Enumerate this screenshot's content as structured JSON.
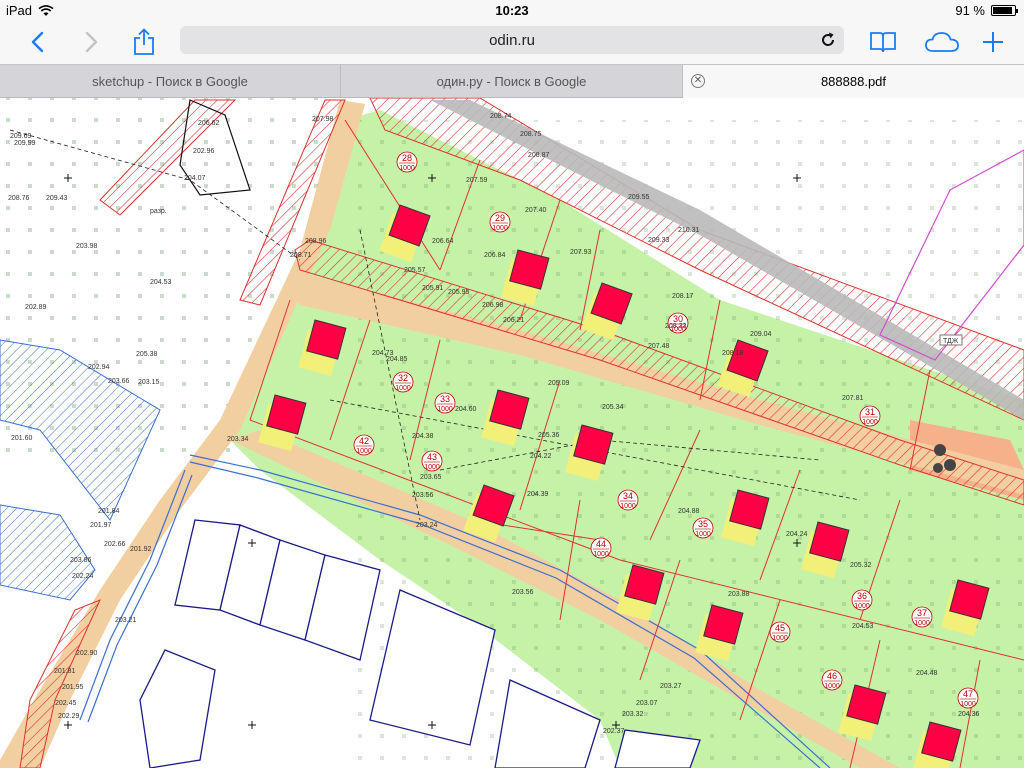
{
  "status": {
    "device": "iPad",
    "time": "10:23",
    "battery": "91 %",
    "battery_level": 0.91
  },
  "browser": {
    "url": "odin.ru"
  },
  "tabs": [
    {
      "label": "sketchup - Поиск в Google"
    },
    {
      "label": "один.ру - Поиск в Google"
    },
    {
      "label": "888888.pdf"
    }
  ],
  "map": {
    "plots": [
      {
        "num": "28",
        "area": "1000"
      },
      {
        "num": "29",
        "area": "1000"
      },
      {
        "num": "30",
        "area": "1000"
      },
      {
        "num": "31",
        "area": "1000"
      },
      {
        "num": "32",
        "area": "1000"
      },
      {
        "num": "33",
        "area": "1000"
      },
      {
        "num": "34",
        "area": "1000"
      },
      {
        "num": "35",
        "area": "1000"
      },
      {
        "num": "36",
        "area": "1000"
      },
      {
        "num": "37",
        "area": "1000"
      },
      {
        "num": "42",
        "area": "1000"
      },
      {
        "num": "43",
        "area": "1000"
      },
      {
        "num": "44",
        "area": "1000"
      },
      {
        "num": "45",
        "area": "1000"
      },
      {
        "num": "46",
        "area": "1000"
      },
      {
        "num": "47",
        "area": "1000"
      }
    ],
    "elevations": [
      "207.98",
      "206.62",
      "202.96",
      "204.07",
      "208.74",
      "208.75",
      "208.87",
      "209.55",
      "206.64",
      "205.57",
      "206.84",
      "207.59",
      "207.40",
      "207.93",
      "209.33",
      "208.17",
      "210.31",
      "205.91",
      "205.95",
      "206.98",
      "206.21",
      "208.18",
      "208.33",
      "207.48",
      "209.04",
      "207.81",
      "204.53",
      "205.38",
      "204.73",
      "204.85",
      "204.60",
      "205.09",
      "205.34",
      "205.36",
      "204.38",
      "204.22",
      "204.39",
      "203.65",
      "203.56",
      "204.88",
      "204.24",
      "205.32",
      "203.88",
      "204.53",
      "204.48",
      "204.36",
      "203.24",
      "203.56",
      "201.84",
      "201.97",
      "202.66",
      "203.86",
      "202.24",
      "201.92",
      "203.21",
      "202.90",
      "201.81",
      "201.95",
      "202.29",
      "202.45",
      "203.27",
      "203.07",
      "203.32",
      "202.37",
      "208.76",
      "203.98",
      "202.89",
      "202.94",
      "203.66",
      "203.15",
      "203.34",
      "201.60",
      "209.69",
      "209.99",
      "209.43",
      "208.96",
      "208.71"
    ],
    "tags": [
      "разр.",
      "ТДЖ"
    ]
  },
  "colors": {
    "plot_green": "#c6f2a8",
    "house_red": "#ff0044",
    "road_tan": "#f2cfa0",
    "hatch_red": "#e03030"
  }
}
